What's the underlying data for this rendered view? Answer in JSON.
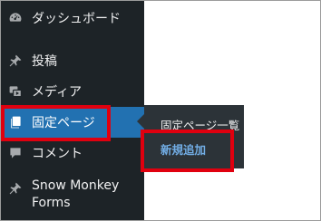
{
  "sidebar": {
    "items": [
      {
        "label": "ダッシュボード",
        "icon": "dashboard-icon"
      },
      {
        "label": "投稿",
        "icon": "pin-icon"
      },
      {
        "label": "メディア",
        "icon": "media-icon"
      },
      {
        "label": "固定ページ",
        "icon": "pages-icon",
        "active": true
      },
      {
        "label": "コメント",
        "icon": "comment-icon"
      },
      {
        "label": "Snow Monkey Forms",
        "icon": "pin-icon"
      }
    ]
  },
  "submenu": {
    "items": [
      {
        "label": "固定ページ一覧"
      },
      {
        "label": "新規追加",
        "current": true
      }
    ]
  },
  "colors": {
    "sidebar_bg": "#1d2327",
    "active_bg": "#2271b1",
    "submenu_bg": "#2c3338",
    "highlight_border": "#e0000f",
    "submenu_current": "#72aee6"
  }
}
